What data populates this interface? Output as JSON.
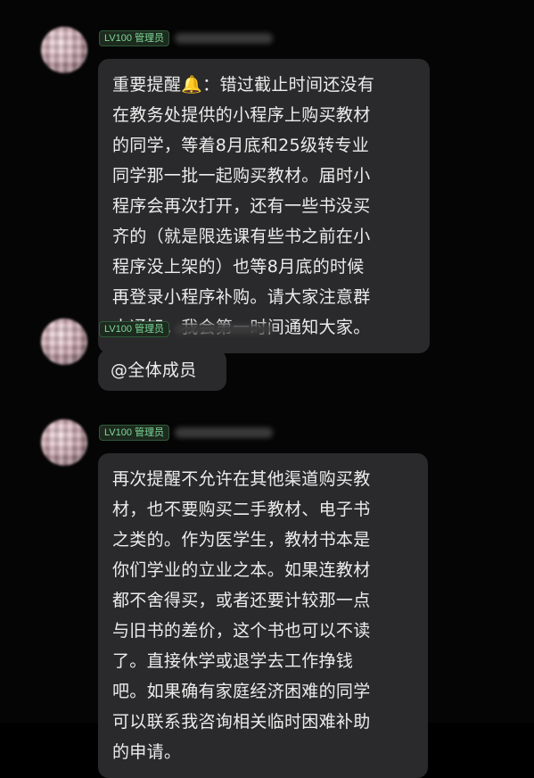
{
  "messages": [
    {
      "badge": "LV100 管理员",
      "lines": [
        "重要提醒🔔：错过截止时间还没有",
        "在教务处提供的小程序上购买教材",
        "的同学，等着8月底和25级转专业",
        "同学那一批一起购买教材。届时小",
        "程序会再次打开，还有一些书没买",
        "齐的（就是限选课有些书之前在小",
        "程序没上架的）也等8月底的时候",
        "再登录小程序补购。请大家注意群",
        "内通知。我会第一时间通知大家。"
      ]
    },
    {
      "badge": "LV100 管理员",
      "lines": [
        "@全体成员"
      ]
    },
    {
      "badge": "LV100 管理员",
      "lines": [
        "再次提醒不允许在其他渠道购买教",
        "材，也不要购买二手教材、电子书",
        "之类的。作为医学生，教材书本是",
        "你们学业的立业之本。如果连教材",
        "都不舍得买，或者还要计较那一点",
        "与旧书的差价，这个书也可以不读",
        "了。直接休学或退学去工作挣钱",
        "吧。如果确有家庭经济困难的同学",
        "可以联系我咨询相关临时困难补助",
        "的申请。"
      ]
    }
  ]
}
